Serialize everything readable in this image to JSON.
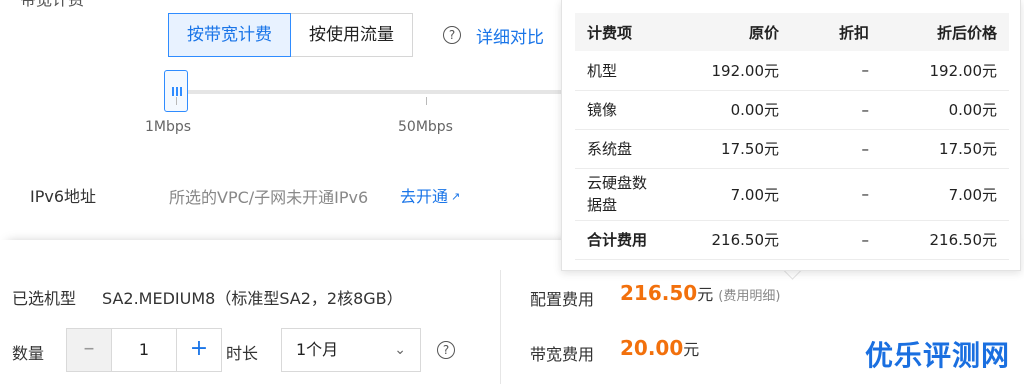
{
  "bandwidth": {
    "partial_label": "带宽计费",
    "options": [
      "按带宽计费",
      "按使用流量"
    ],
    "selected": "按带宽计费",
    "compare_link": "详细对比",
    "slider": {
      "value_mbps": 1,
      "tick_labels": [
        "1Mbps",
        "50Mbps"
      ]
    }
  },
  "ipv6": {
    "label": "IPv6地址",
    "message": "所选的VPC/子网未开通IPv6",
    "action_link": "去开通"
  },
  "popup": {
    "headers": [
      "计费项",
      "原价",
      "折扣",
      "折后价格"
    ],
    "rows": [
      {
        "item": "机型",
        "original": "192.00元",
        "discount": "–",
        "final": "192.00元"
      },
      {
        "item": "镜像",
        "original": "0.00元",
        "discount": "–",
        "final": "0.00元"
      },
      {
        "item": "系统盘",
        "original": "17.50元",
        "discount": "–",
        "final": "17.50元"
      },
      {
        "item": "云硬盘数据盘",
        "item_line1": "云硬盘数",
        "item_line2": "据盘",
        "original": "7.00元",
        "discount": "–",
        "final": "7.00元"
      },
      {
        "item": "合计费用",
        "original": "216.50元",
        "discount": "–",
        "final": "216.50元"
      }
    ]
  },
  "summary": {
    "model_label": "已选机型",
    "model_value": "SA2.MEDIUM8（标准型SA2，2核8GB）",
    "quantity_label": "数量",
    "quantity_value": "1",
    "duration_label": "时长",
    "duration_value": "1个月",
    "config_fee_label": "配置费用",
    "config_fee_value": "216.50",
    "fee_detail_link": "(费用明细)",
    "bandwidth_fee_label": "带宽费用",
    "bandwidth_fee_value": "20.00",
    "currency_unit": "元"
  },
  "watermark": "优乐评测网",
  "colors": {
    "accent": "#1a75e8",
    "price": "#f2700c",
    "active_bg": "#e8f2ff"
  }
}
